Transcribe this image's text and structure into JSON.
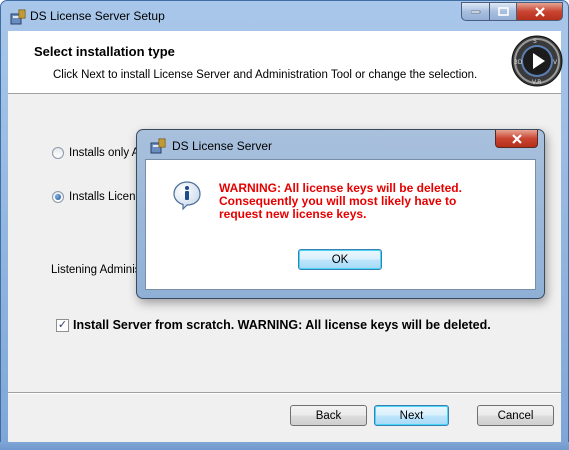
{
  "window": {
    "title": "DS License Server Setup"
  },
  "header": {
    "title": "Select installation type",
    "subtitle": "Click Next to install License Server and Administration Tool or change the selection."
  },
  "options": {
    "radio1_label": "Installs only A",
    "radio2_label": "Installs Licenc",
    "radio_selected": 2,
    "listening_label": "Listening Adminis"
  },
  "checkbox": {
    "label": "Install Server from scratch. WARNING: All license keys will be deleted.",
    "checked": true
  },
  "footer": {
    "back_label": "Back",
    "next_label": "Next",
    "cancel_label": "Cancel"
  },
  "dialog": {
    "title": "DS License Server",
    "message_lines": [
      "WARNING: All license keys will be deleted.",
      "Consequently you will most likely have to",
      "request new license keys."
    ],
    "ok_label": "OK",
    "message_color": "#e60000"
  },
  "icons": {
    "app": "installer-icon",
    "info": "info-icon",
    "logo": "ds-logo-icon"
  },
  "colors": {
    "titlebar": "#a9c7ea",
    "close_button": "#c94532",
    "warning_text": "#e60000"
  }
}
